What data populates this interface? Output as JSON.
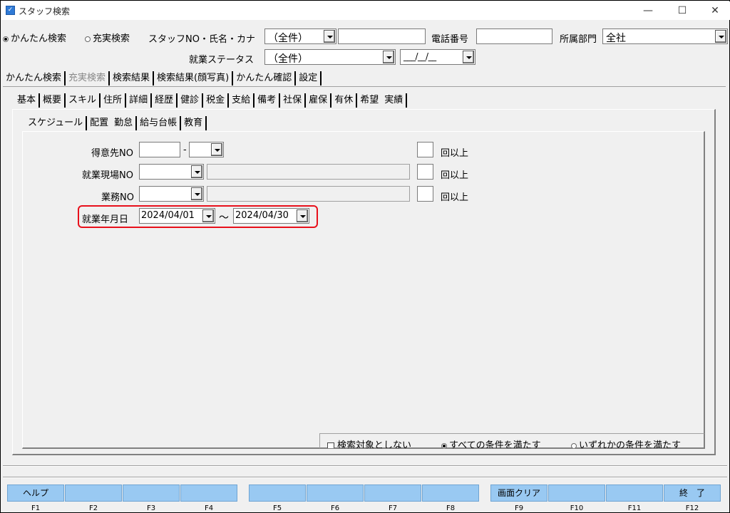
{
  "window": {
    "title": "スタッフ検索",
    "minimize": "—",
    "maximize": "☐",
    "close": "✕"
  },
  "search": {
    "mode_simple": "かんたん検索",
    "mode_full": "充実検索",
    "staff_label": "スタッフNO・氏名・カナ",
    "staff_combo": "（全件）",
    "staff_text": "",
    "phone_label": "電話番号",
    "phone_value": "",
    "dept_label": "所属部門",
    "dept_value": "全社",
    "status_label": "就業ステータス",
    "status_value": "（全件）",
    "date_value": "___/__/__"
  },
  "main_tabs": [
    "かんたん検索",
    "充実検索",
    "検索結果",
    "検索結果(顔写真)",
    "かんたん確認",
    "設定"
  ],
  "sub_tabs": [
    "基本",
    "概要",
    "スキル",
    "住所",
    "詳細",
    "経歴",
    "健診",
    "税金",
    "支給",
    "備考",
    "社保",
    "雇保",
    "有休",
    "希望",
    "実績"
  ],
  "inner_tabs": [
    "スケジュール",
    "配置",
    "勤怠",
    "給与台帳",
    "教育"
  ],
  "form": {
    "client_label": "得意先NO",
    "client_sep": "-",
    "site_label": "就業現場NO",
    "task_label": "業務NO",
    "times_label": "回以上",
    "date_label": "就業年月日",
    "date_from": "2024/04/01",
    "date_tilde": "～",
    "date_to": "2024/04/30"
  },
  "conditions": {
    "exclude": "検索対象としない",
    "all": "すべての条件を満たす",
    "any": "いずれかの条件を満たす"
  },
  "fkeys": [
    {
      "label": "ヘルプ",
      "key": "F1"
    },
    {
      "label": "",
      "key": "F2"
    },
    {
      "label": "",
      "key": "F3"
    },
    {
      "label": "",
      "key": "F4"
    },
    {
      "label": "",
      "key": "F5"
    },
    {
      "label": "",
      "key": "F6"
    },
    {
      "label": "",
      "key": "F7"
    },
    {
      "label": "",
      "key": "F8"
    },
    {
      "label": "画面クリア",
      "key": "F9"
    },
    {
      "label": "",
      "key": "F10"
    },
    {
      "label": "",
      "key": "F11"
    },
    {
      "label": "終　了",
      "key": "F12"
    }
  ],
  "colors": {
    "highlight": "#e8101b",
    "fkey_button": "#99c9f2"
  }
}
